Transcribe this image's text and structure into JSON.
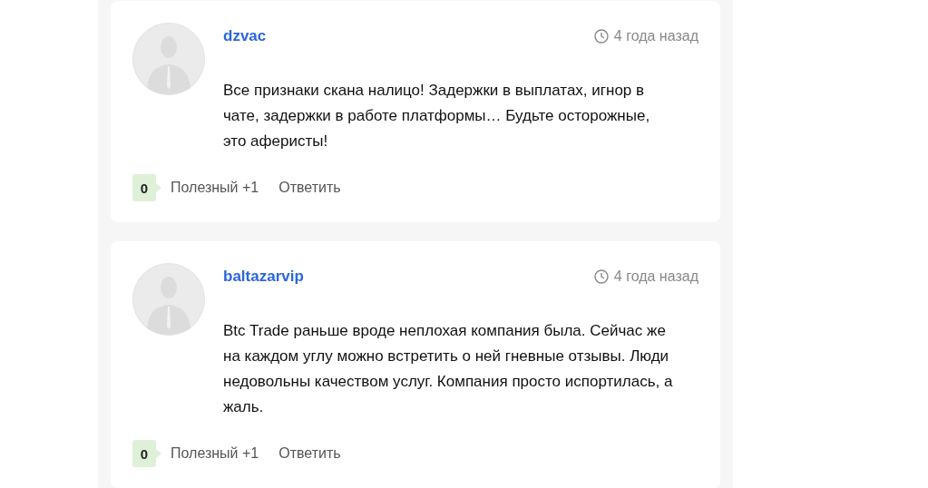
{
  "comments": [
    {
      "author": "dzvac",
      "time": "4 года назад",
      "text": "Все признаки скана налицо! Задержки в выплатах, игнор в чате, задержки в работе платформы… Будьте осторожные, это аферисты!",
      "votes": "0",
      "useful": "Полезный +1",
      "reply": "Ответить"
    },
    {
      "author": "baltazarvip",
      "time": "4 года назад",
      "text": "Btc Trade раньше вроде неплохая компания была. Сейчас же на каждом углу можно встретить о ней гневные отзывы. Люди недовольны качеством услуг. Компания просто испортилась, а жаль.",
      "votes": "0",
      "useful": "Полезный +1",
      "reply": "Ответить"
    }
  ]
}
